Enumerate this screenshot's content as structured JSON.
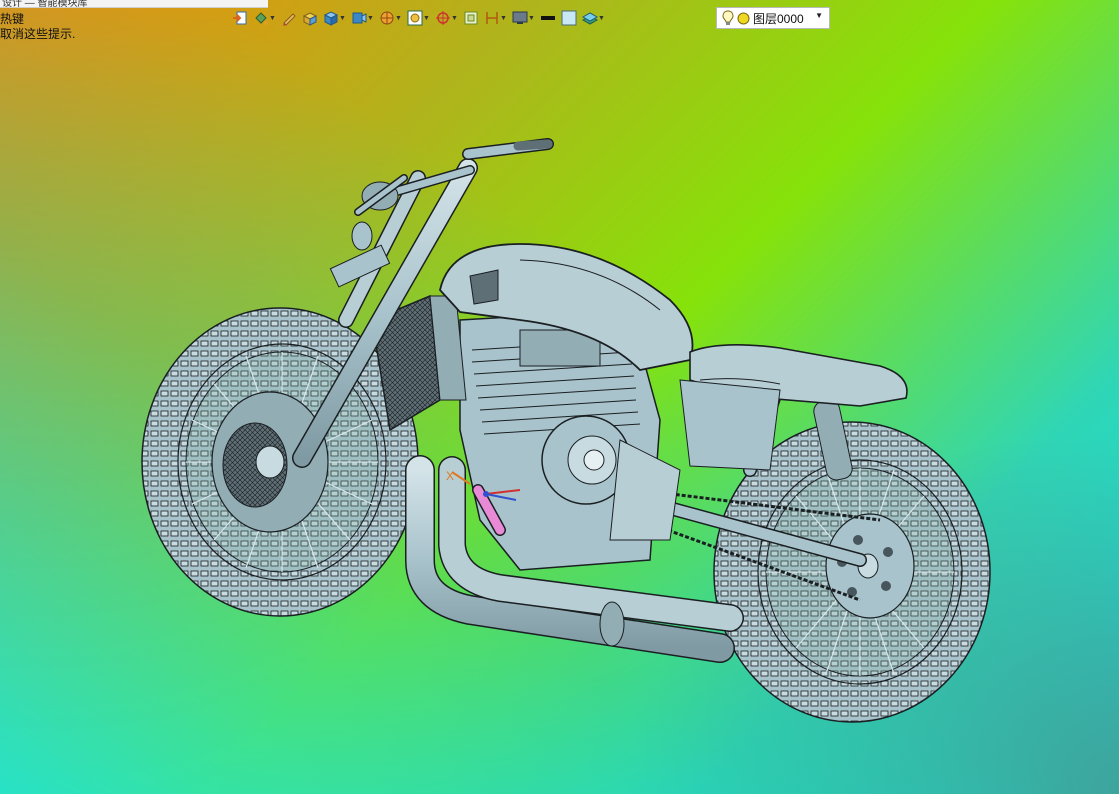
{
  "top_strip": {
    "text": "设计 — 智能模块库"
  },
  "hints": {
    "line1": "热键",
    "line2": "取消这些提示."
  },
  "toolbar": {
    "buttons": [
      {
        "name": "import-icon",
        "has_dropdown": false
      },
      {
        "name": "paint-bucket-icon",
        "has_dropdown": true
      },
      {
        "name": "pen-icon",
        "has_dropdown": false
      },
      {
        "name": "solid-shading-icon",
        "has_dropdown": false
      },
      {
        "name": "cube-view-icon",
        "has_dropdown": true
      },
      {
        "name": "camera-icon",
        "has_dropdown": true
      },
      {
        "name": "section-icon",
        "has_dropdown": true
      },
      {
        "name": "fit-view-icon",
        "has_dropdown": true
      },
      {
        "name": "snap-target-icon",
        "has_dropdown": true
      },
      {
        "name": "frame-icon",
        "has_dropdown": false
      },
      {
        "name": "measure-icon",
        "has_dropdown": true
      },
      {
        "name": "display-icon",
        "has_dropdown": true
      },
      {
        "name": "line-color-icon",
        "has_dropdown": false
      },
      {
        "name": "fill-color-icon",
        "has_dropdown": false
      },
      {
        "name": "layers-icon",
        "has_dropdown": true
      }
    ]
  },
  "layer": {
    "name": "图层0000",
    "bulb_icon": "lightbulb-icon",
    "color_icon": "yellow-circle-icon"
  },
  "colors": {
    "gradient_top_left": "#f08c0a",
    "gradient_top_right": "#86e20a",
    "gradient_bottom_left": "#0fe0e4",
    "model_fill": "#a9c3cc",
    "model_edge": "#1a1f22"
  }
}
